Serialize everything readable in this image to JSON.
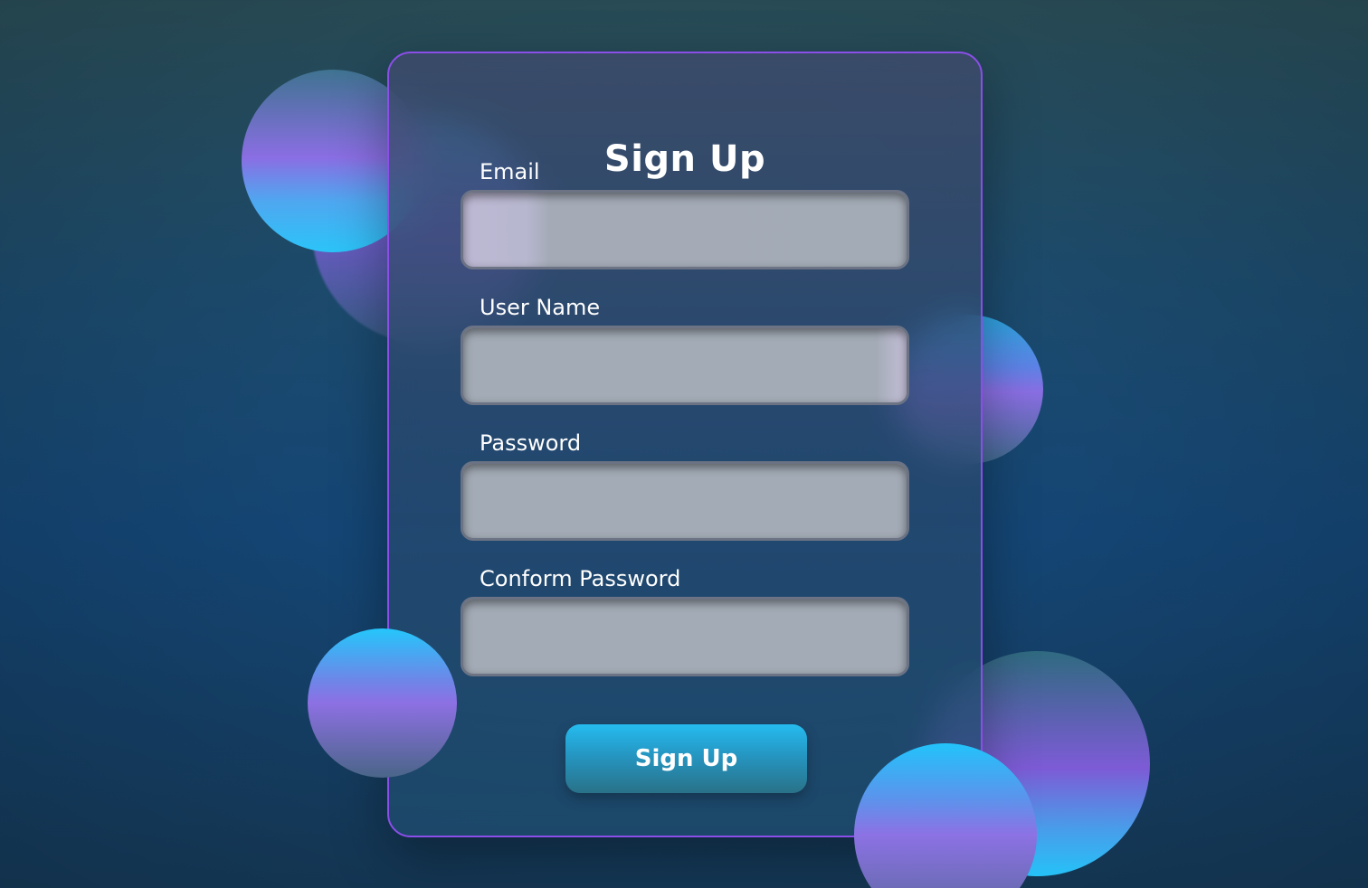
{
  "form": {
    "title": "Sign Up",
    "fields": [
      {
        "label": "Email",
        "value": "",
        "placeholder": ""
      },
      {
        "label": "User Name",
        "value": "",
        "placeholder": ""
      },
      {
        "label": "Password",
        "value": "",
        "placeholder": ""
      },
      {
        "label": "Conform Password",
        "value": "",
        "placeholder": ""
      }
    ],
    "submit_label": "Sign Up"
  },
  "colors": {
    "card_border": "#8b4ee8",
    "button_top": "#25bcf0",
    "button_bottom": "#297288",
    "orb_purple": "#8a6ee3",
    "orb_cyan": "#2bc4f8"
  }
}
